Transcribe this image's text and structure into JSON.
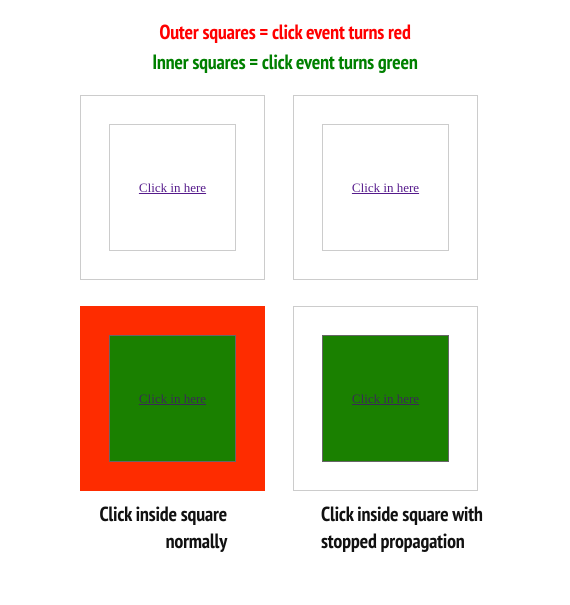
{
  "headings": {
    "outer": "Outer squares = click event turns red",
    "inner": "Inner squares = click event turns green"
  },
  "link_text": "Click in here",
  "captions": {
    "left": "Click inside square normally",
    "right": "Click inside square with stopped propagation"
  }
}
